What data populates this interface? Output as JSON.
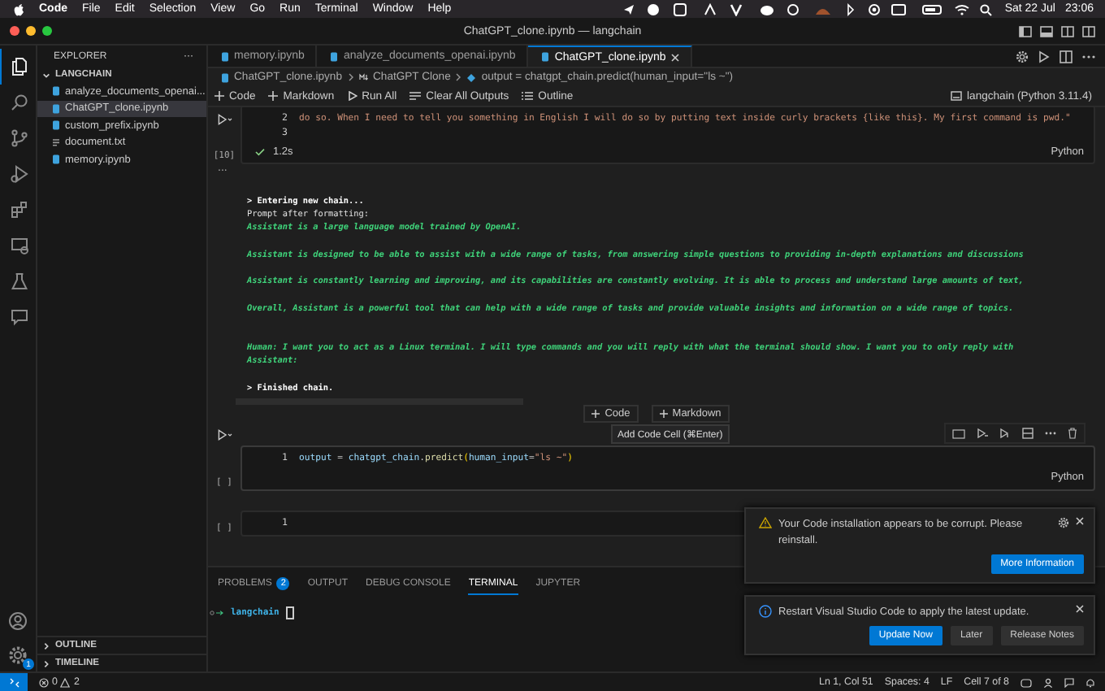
{
  "menu_bar": {
    "app": "Code",
    "items": [
      "File",
      "Edit",
      "Selection",
      "View",
      "Go",
      "Run",
      "Terminal",
      "Window",
      "Help"
    ],
    "date": "Sat 22 Jul",
    "time": "23:06"
  },
  "window": {
    "title": "ChatGPT_clone.ipynb — langchain"
  },
  "activity_bar": {
    "items": [
      {
        "kind": "files",
        "selected": true
      },
      {
        "kind": "search",
        "selected": false
      },
      {
        "kind": "source-control",
        "selected": false
      },
      {
        "kind": "run",
        "selected": false
      },
      {
        "kind": "extensions",
        "selected": false
      },
      {
        "kind": "remote",
        "selected": false
      },
      {
        "kind": "testing",
        "selected": false
      },
      {
        "kind": "chat",
        "selected": false
      }
    ],
    "settings_badge": "1"
  },
  "sidebar": {
    "title": "EXPLORER",
    "more": "···",
    "folder": "LANGCHAIN",
    "expanded": true,
    "files": [
      {
        "name": "analyze_documents_openai...",
        "kind": "notebook",
        "selected": false
      },
      {
        "name": "ChatGPT_clone.ipynb",
        "kind": "notebook",
        "selected": true
      },
      {
        "name": "custom_prefix.ipynb",
        "kind": "notebook",
        "selected": false
      },
      {
        "name": "document.txt",
        "kind": "text",
        "selected": false
      },
      {
        "name": "memory.ipynb",
        "kind": "notebook",
        "selected": false
      }
    ],
    "sections": [
      {
        "label": "OUTLINE",
        "expanded": false
      },
      {
        "label": "TIMELINE",
        "expanded": false
      }
    ]
  },
  "tabs": [
    {
      "label": "memory.ipynb",
      "selected": false
    },
    {
      "label": "analyze_documents_openai.ipynb",
      "selected": false
    },
    {
      "label": "ChatGPT_clone.ipynb",
      "selected": true
    }
  ],
  "breadcrumb": [
    "ChatGPT_clone.ipynb",
    "ChatGPT Clone",
    "output = chatgpt_chain.predict(human_input=\"ls ~\")"
  ],
  "toolbar": [
    {
      "kind": "add",
      "label": "Code"
    },
    {
      "kind": "add",
      "label": "Markdown"
    },
    {
      "kind": "run",
      "label": "Run All"
    },
    {
      "kind": "clear",
      "label": "Clear All Outputs"
    },
    {
      "kind": "outline",
      "label": "Outline"
    }
  ],
  "kernel": "langchain (Python 3.11.4)",
  "cells": [
    {
      "lines": [
        {
          "number": "2",
          "tokens": [
            {
              "kind": "string",
              "text": "do so. When I need to tell you something in English I will do so by putting text inside curly brackets {like this}. My first command is pwd.\""
            }
          ]
        },
        {
          "number": "3"
        }
      ],
      "execution_count": "[10]",
      "succeeded": true,
      "duration": "1.2s",
      "language": "Python",
      "output_toggle": "...",
      "output": [
        {
          "kind": "chain",
          "text": "> Entering new  chain..."
        },
        {
          "kind": "plain",
          "text": "Prompt after formatting:"
        },
        {
          "kind": "prompt",
          "text": "Assistant is a large language model trained by OpenAI."
        },
        {
          "kind": "blank"
        },
        {
          "kind": "prompt",
          "text": "Assistant is designed to be able to assist with a wide range of tasks, from answering simple questions to providing in-depth explanations and discussions"
        },
        {
          "kind": "blank"
        },
        {
          "kind": "prompt",
          "text": "Assistant is constantly learning and improving, and its capabilities are constantly evolving. It is able to process and understand large amounts of text,"
        },
        {
          "kind": "blank"
        },
        {
          "kind": "prompt",
          "text": "Overall, Assistant is a powerful tool that can help with a wide range of tasks and provide valuable insights and information on a wide range of topics."
        },
        {
          "kind": "blank"
        },
        {
          "kind": "blank"
        },
        {
          "kind": "prompt",
          "text": "Human: I want you to act as a Linux terminal. I will type commands and you will reply with what the terminal should show. I want you to only reply with"
        },
        {
          "kind": "prompt",
          "text": "Assistant:"
        },
        {
          "kind": "blank"
        },
        {
          "kind": "chain",
          "text": "> Finished chain."
        }
      ]
    },
    {
      "lines": [
        {
          "number": "1",
          "tokens": [
            {
              "kind": "variable",
              "text": "output"
            },
            {
              "kind": "operator",
              "text": " = "
            },
            {
              "kind": "variable",
              "text": "chatgpt_chain"
            },
            {
              "kind": "operator",
              "text": "."
            },
            {
              "kind": "function",
              "text": "predict"
            },
            {
              "kind": "bracket",
              "text": "("
            },
            {
              "kind": "variable",
              "text": "human_input"
            },
            {
              "kind": "operator",
              "text": "="
            },
            {
              "kind": "string",
              "text": "\"ls ~\""
            },
            {
              "kind": "bracket",
              "text": ")"
            }
          ]
        }
      ],
      "execution_count": "[ ]",
      "language": "Python",
      "focused": true
    },
    {
      "lines": [
        {
          "number": "1"
        }
      ],
      "execution_count": "[ ]"
    }
  ],
  "add_cell": {
    "buttons": [
      "Code",
      "Markdown"
    ],
    "tooltip": "Add Code Cell (⌘Enter)"
  },
  "panel": {
    "tabs": [
      {
        "label": "PROBLEMS",
        "badge": "2",
        "selected": false
      },
      {
        "label": "OUTPUT",
        "selected": false
      },
      {
        "label": "DEBUG CONSOLE",
        "selected": false
      },
      {
        "label": "TERMINAL",
        "selected": true
      },
      {
        "label": "JUPYTER",
        "selected": false
      }
    ],
    "terminal": {
      "prompt": "langchain"
    }
  },
  "notifications": [
    {
      "kind": "warning",
      "message": "Your Code installation appears to be corrupt. Please reinstall.",
      "buttons": [
        {
          "label": "More Information",
          "primary": true
        }
      ]
    },
    {
      "kind": "info",
      "message": "Restart Visual Studio Code to apply the latest update.",
      "buttons": [
        {
          "label": "Update Now",
          "primary": true
        },
        {
          "label": "Later",
          "primary": false
        },
        {
          "label": "Release Notes",
          "primary": false
        }
      ]
    }
  ],
  "status_bar": {
    "errors": "0",
    "warnings": "2",
    "items": [
      "Ln 1, Col 51",
      "Spaces: 4",
      "LF",
      "Cell 7 of 8"
    ]
  }
}
